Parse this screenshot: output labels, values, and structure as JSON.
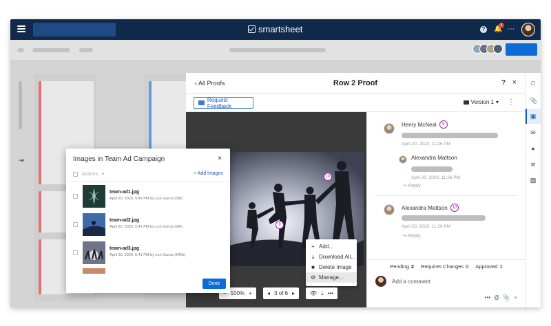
{
  "app": {
    "name": "smartsheet",
    "notification_count": "4"
  },
  "proof": {
    "back_label": "All Proofs",
    "title": "Row 2 Proof",
    "help": "?",
    "close": "×",
    "request_feedback": "Request Feedback",
    "version": "Version 1",
    "zoom": "100%",
    "page": "3 of 6",
    "markers": [
      "10",
      "9"
    ],
    "menu": [
      {
        "icon": "+",
        "label": "Add..."
      },
      {
        "icon": "download-icon",
        "label": "Download All..."
      },
      {
        "icon": "trash-icon",
        "label": "Delete Image"
      },
      {
        "icon": "gear-icon",
        "label": "Manage..."
      }
    ]
  },
  "comments": [
    {
      "name": "Henry McNeal",
      "badge": "9",
      "time": "April 20, 2020, 11:26 PM"
    },
    {
      "name": "Alexandra Mattson",
      "badge": "",
      "time": "April 20, 2020, 11:26 PM",
      "reply_label": "Reply"
    },
    {
      "name": "Alexandra Mattson",
      "badge": "10",
      "time": "April 20, 2020, 11:29 PM",
      "reply_label": "Reply"
    }
  ],
  "status": {
    "pending_label": "Pending",
    "pending": "2",
    "requires_label": "Requires Changes",
    "requires": "0",
    "approved_label": "Approved",
    "approved": "1"
  },
  "add_comment_placeholder": "Add a comment",
  "dialog": {
    "title": "Images in Team Ad Campaign",
    "close": "×",
    "actions_label": "Actions",
    "add_images": "+ Add Images",
    "done": "Done",
    "images": [
      {
        "name": "team-ad1.jpg",
        "meta": "April 20, 2020, 5:41 PM by Lori Garcia (3M)"
      },
      {
        "name": "team-ad2.jpg",
        "meta": "April 20, 2020, 5:41 PM by Lori Garcia (2M)"
      },
      {
        "name": "team-ad3.jpg",
        "meta": "April 20, 2020, 5:41 PM by Lori Garcia (640k)"
      }
    ]
  },
  "colors": {
    "brand_navy": "#0f2a4a",
    "primary_blue": "#0d6bd6",
    "marker_purple": "#9c27b0",
    "approved_green": "#2e7d32",
    "requires_red": "#e53935"
  }
}
